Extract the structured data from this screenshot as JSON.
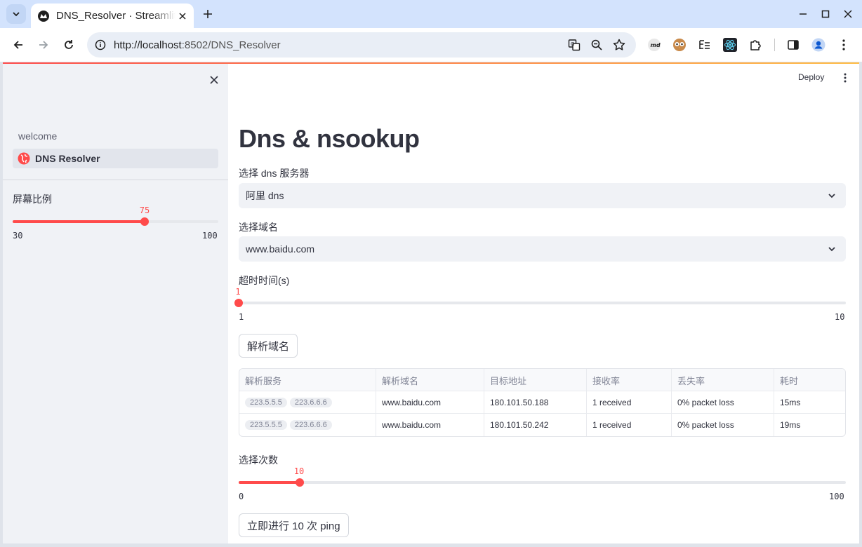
{
  "browser": {
    "tab_title": "DNS_Resolver · Streamlit",
    "url_host": "http://localhost",
    "url_rest": ":8502/DNS_Resolver"
  },
  "extensions": [
    "md-icon",
    "owl-icon",
    "outline-icon",
    "react-icon",
    "puzzle-icon"
  ],
  "header": {
    "deploy_label": "Deploy"
  },
  "sidebar": {
    "nav": [
      {
        "label": "welcome",
        "active": false
      },
      {
        "label": "DNS Resolver",
        "active": true
      }
    ],
    "slider": {
      "label": "屏幕比例",
      "value": 75,
      "min": 30,
      "max": 100,
      "value_text": "75",
      "min_text": "30",
      "max_text": "100"
    }
  },
  "main": {
    "title": "Dns & nsookup",
    "dns_select": {
      "label": "选择 dns 服务器",
      "value": "阿里 dns"
    },
    "domain_select": {
      "label": "选择域名",
      "value": "www.baidu.com"
    },
    "timeout_slider": {
      "label": "超时时间(s)",
      "value": 1,
      "min": 1,
      "max": 10,
      "value_text": "1",
      "min_text": "1",
      "max_text": "10"
    },
    "resolve_button": "解析域名",
    "table": {
      "columns": [
        "解析服务",
        "解析域名",
        "目标地址",
        "接收率",
        "丢失率",
        "耗时"
      ],
      "rows": [
        {
          "servers": [
            "223.5.5.5",
            "223.6.6.6"
          ],
          "domain": "www.baidu.com",
          "address": "180.101.50.188",
          "received": "1 received",
          "loss": "0% packet loss",
          "time": "15ms"
        },
        {
          "servers": [
            "223.5.5.5",
            "223.6.6.6"
          ],
          "domain": "www.baidu.com",
          "address": "180.101.50.242",
          "received": "1 received",
          "loss": "0% packet loss",
          "time": "19ms"
        }
      ]
    },
    "count_slider": {
      "label": "选择次数",
      "value": 10,
      "min": 0,
      "max": 100,
      "value_text": "10",
      "min_text": "0",
      "max_text": "100"
    },
    "ping_button": "立即进行 10 次 ping"
  },
  "colors": {
    "accent": "#ff4b4b",
    "sidebar_bg": "#f0f2f6",
    "tabbar_bg": "#d3e3fd"
  }
}
